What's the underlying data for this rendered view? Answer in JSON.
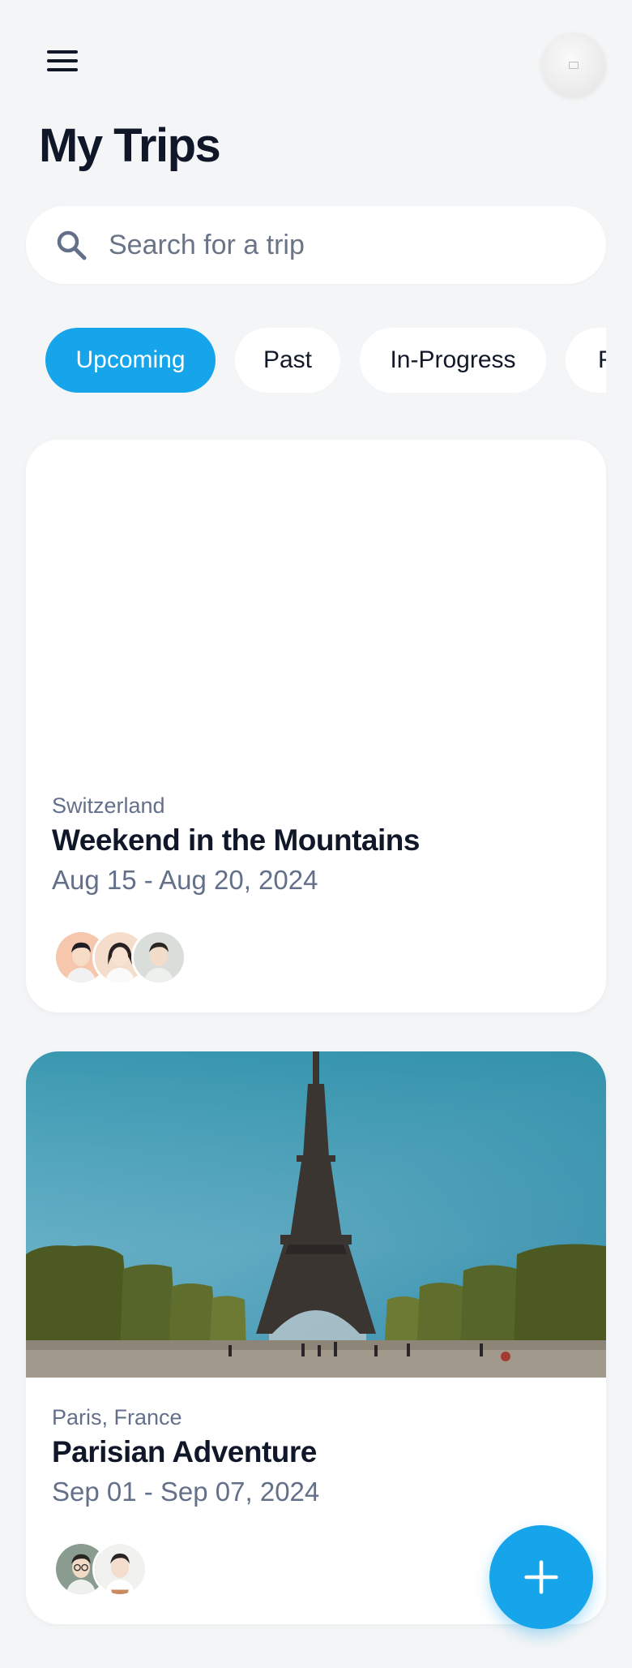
{
  "header": {
    "title": "My Trips",
    "menu_icon": "hamburger-menu-icon",
    "profile_icon": "profile-avatar"
  },
  "search": {
    "placeholder": "Search for a trip",
    "value": "",
    "icon": "search-icon"
  },
  "filters": {
    "chips": [
      {
        "label": "Upcoming",
        "active": true
      },
      {
        "label": "Past",
        "active": false
      },
      {
        "label": "In-Progress",
        "active": false
      },
      {
        "label": "F",
        "active": false
      }
    ]
  },
  "trips": [
    {
      "location": "Switzerland",
      "title": "Weekend in the Mountains",
      "dates": "Aug 15 - Aug 20, 2024",
      "image": "blank",
      "participants": [
        "person-avatar",
        "person-avatar",
        "person-avatar"
      ]
    },
    {
      "location": "Paris, France",
      "title": "Parisian Adventure",
      "dates": "Sep 01 - Sep 07, 2024",
      "image": "eiffel-tower-photo",
      "participants": [
        "person-avatar",
        "person-avatar"
      ]
    }
  ],
  "fab": {
    "icon": "plus-icon"
  },
  "colors": {
    "accent": "#16a4ea",
    "background": "#f4f5f6",
    "card": "#ffffff",
    "title_text": "#0f1729",
    "muted_text": "#64708a"
  }
}
